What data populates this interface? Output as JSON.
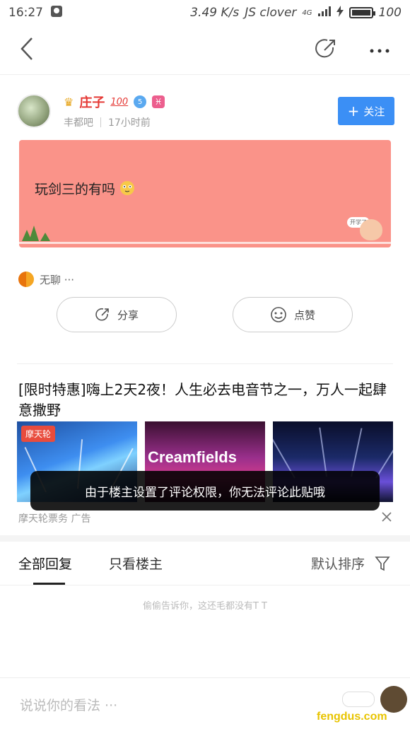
{
  "status_bar": {
    "time": "16:27",
    "network_speed": "3.49 K/s",
    "carrier_text": "JS clover",
    "signal_label": "4G",
    "battery_text": "100",
    "battery_level": 1.0
  },
  "nav": {
    "back_icon": "chevron-left-icon",
    "share_icon": "share-icon",
    "more_icon": "more-icon"
  },
  "author": {
    "name": "庄子",
    "badge_hundred": "100",
    "level": "5",
    "zodiac_glyph": "♓",
    "forum": "丰都吧",
    "time_ago": "17小时前",
    "follow_label": "关注"
  },
  "post": {
    "text": "玩剑三的有吗",
    "mascot_bubble": "开学了",
    "card_color": "#fa9389"
  },
  "forum_tag": {
    "label": "无聊 ···"
  },
  "actions": {
    "share_label": "分享",
    "like_label": "点赞"
  },
  "ad": {
    "title": "[限时特惠]嗨上2天2夜！人生必去电音节之一，万人一起肆意撒野",
    "image1_badge": "摩天轮",
    "image2_brand": "Creamfields",
    "source": "摩天轮票务  广告"
  },
  "toast": {
    "text": "由于楼主设置了评论权限，你无法评论此贴哦"
  },
  "tabs": {
    "all_replies": "全部回复",
    "only_op": "只看楼主",
    "sort_label": "默认排序"
  },
  "empty_text": "偷偷告诉你，这还毛都没有T T",
  "comment_placeholder": "说说你的看法 ···",
  "watermark": "fengdus.com",
  "colors": {
    "accent_blue": "#3b8ff5",
    "username_red": "#e53935"
  }
}
